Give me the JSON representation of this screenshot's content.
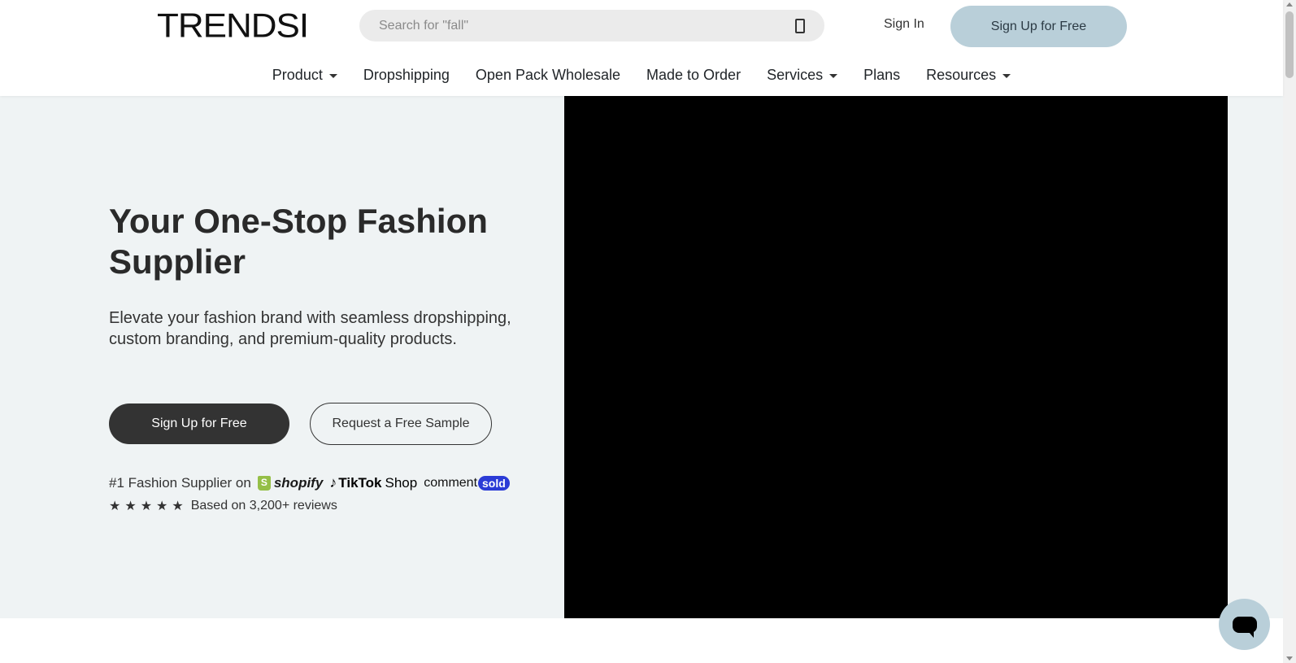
{
  "header": {
    "logo": "TRENDSI",
    "search_placeholder": "Search for \"fall\"",
    "search_icon": "phone-outline-icon",
    "sign_in": "Sign In",
    "sign_up": "Sign Up for Free",
    "accent_color": "#b9cfd9"
  },
  "nav": {
    "items": [
      {
        "label": "Product",
        "dropdown": true
      },
      {
        "label": "Dropshipping",
        "dropdown": false
      },
      {
        "label": "Open Pack Wholesale",
        "dropdown": false
      },
      {
        "label": "Made to Order",
        "dropdown": false
      },
      {
        "label": "Services",
        "dropdown": true
      },
      {
        "label": "Plans",
        "dropdown": false
      },
      {
        "label": "Resources",
        "dropdown": true
      }
    ]
  },
  "hero": {
    "title": "Your One-Stop Fashion Supplier",
    "subtitle": "Elevate your fashion brand with seamless dropshipping, custom branding, and premium-quality products.",
    "primary_cta": "Sign Up for Free",
    "secondary_cta": "Request a Free Sample",
    "trust_text": "#1 Fashion Supplier on",
    "partners": {
      "shopify": "shopify",
      "tiktok": "TikTok",
      "tiktok_shop": "Shop",
      "comment": "comment",
      "sold": "sold"
    },
    "stars": "★★★★★",
    "rating_count": 5,
    "reviews_text": "Based on 3,200+ reviews",
    "background_color": "#eff3f4",
    "video_color": "#000000"
  },
  "chat": {
    "icon": "chat-bubble-icon"
  }
}
